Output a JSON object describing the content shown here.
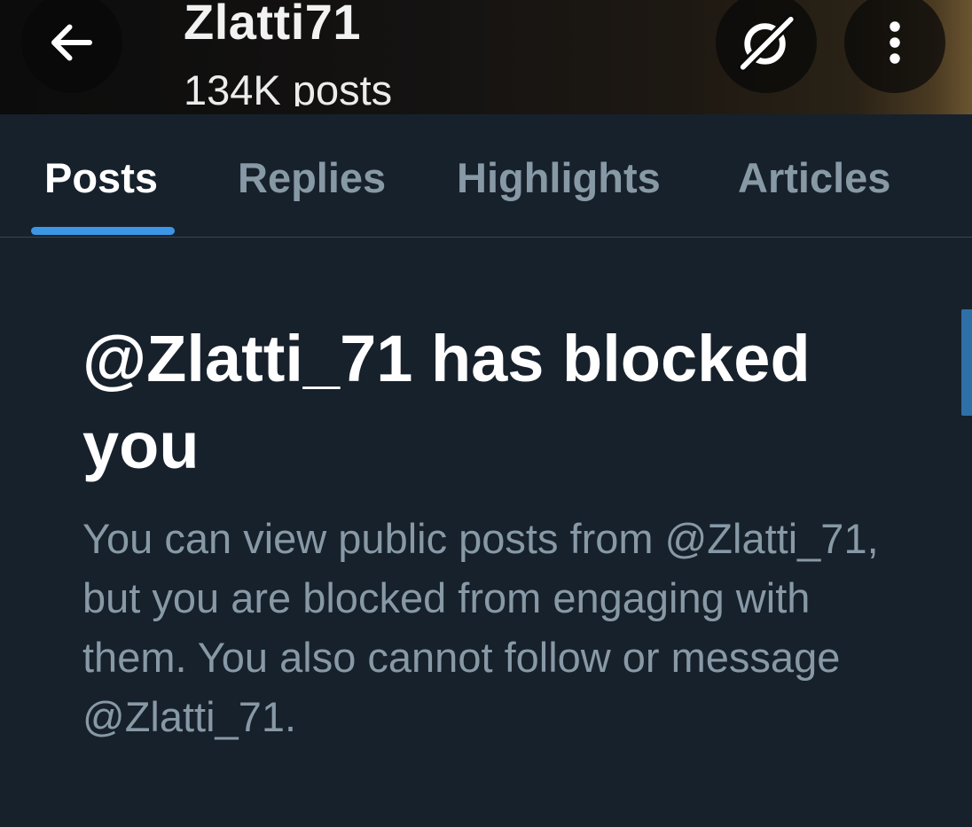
{
  "header": {
    "profile_name": "Zlatti71",
    "post_count": "134K posts"
  },
  "icons": {
    "back": "arrow-left-icon",
    "grok": "grok-icon",
    "more": "more-vertical-icon"
  },
  "tabs": [
    {
      "label": "Posts",
      "active": true
    },
    {
      "label": "Replies",
      "active": false
    },
    {
      "label": "Highlights",
      "active": false
    },
    {
      "label": "Articles",
      "active": false
    }
  ],
  "blocked": {
    "title": "@Zlatti_71 has blocked you",
    "message": "You can view public posts from @Zlatti_71, but you are blocked from engaging with them. You also cannot follow or message @Zlatti_71."
  },
  "colors": {
    "background": "#17212c",
    "accent": "#3b96e6",
    "secondary_text": "#8899a6",
    "divider": "#38444d"
  }
}
